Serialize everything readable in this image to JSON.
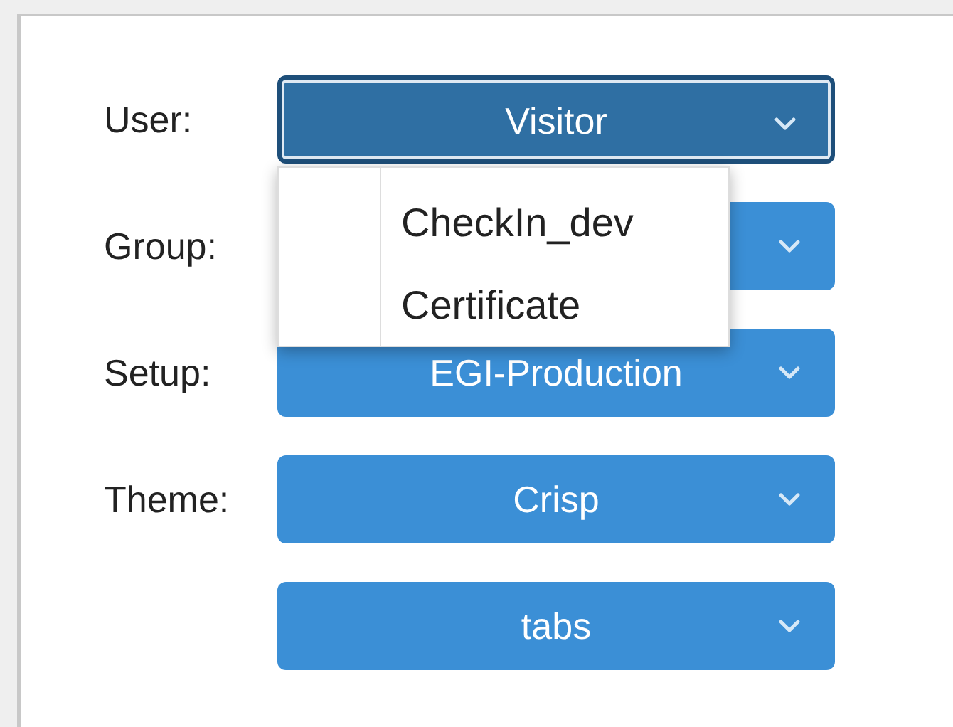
{
  "fields": [
    {
      "label": "User:",
      "value": "Visitor",
      "expanded": true,
      "options": [
        "CheckIn_dev",
        "Certificate"
      ]
    },
    {
      "label": "Group:",
      "expanded": false
    },
    {
      "label": "Setup:",
      "value": "EGI-Production",
      "expanded": false
    },
    {
      "label": "Theme:",
      "value": "Crisp",
      "expanded": false
    },
    {
      "value": "tabs",
      "expanded": false
    }
  ]
}
